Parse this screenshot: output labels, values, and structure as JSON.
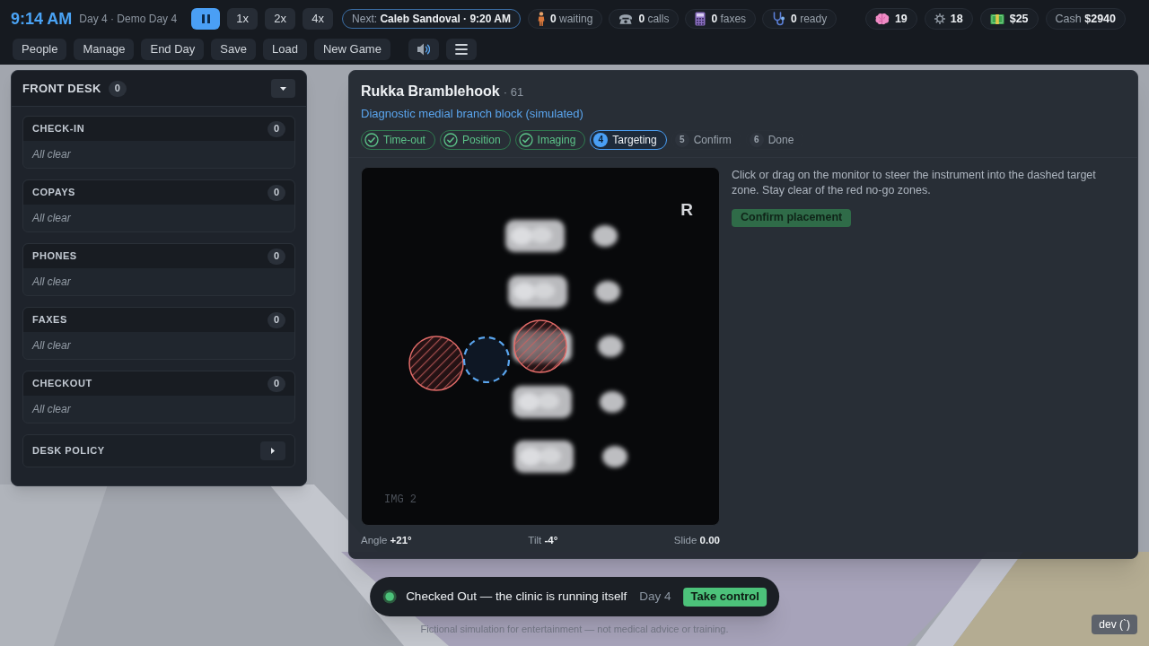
{
  "top_bar": {
    "clock": "9:14 AM",
    "day": "Day 4 · Demo Day 4",
    "speed_controls": [
      {
        "kind": "pause",
        "selected": true
      },
      {
        "kind": "speed",
        "label": "1x",
        "selected": false
      },
      {
        "kind": "speed",
        "label": "2x",
        "selected": false
      },
      {
        "kind": "speed",
        "label": "4x",
        "selected": false
      }
    ],
    "next": "Next: **Caleb Sandoval · 9:20 AM**",
    "counters": [
      {
        "kind": "waiting",
        "text": "**0** waiting"
      },
      {
        "kind": "calls",
        "text": "**0** calls"
      },
      {
        "kind": "faxes",
        "text": "**0** faxes"
      },
      {
        "kind": "ready",
        "text": "**0** ready"
      }
    ],
    "stats": [
      {
        "kind": "brain",
        "text": "19"
      },
      {
        "kind": "gear",
        "text": "18"
      },
      {
        "kind": "money",
        "text": "$25"
      },
      {
        "kind": "cash",
        "text": "Cash **$2940**"
      }
    ]
  },
  "menu_buttons": [
    {
      "label": "People"
    },
    {
      "label": "Manage"
    },
    {
      "label": "End Day"
    },
    {
      "label": "Save"
    },
    {
      "label": "Load"
    },
    {
      "label": "New Game"
    }
  ],
  "icon_buttons": [
    {
      "kind": "sound"
    },
    {
      "kind": "menu"
    }
  ],
  "front_desk": {
    "title": "FRONT DESK",
    "count": "0",
    "expanded": true,
    "sections": [
      {
        "title": "CHECK-IN",
        "count": "0",
        "message": "All clear"
      },
      {
        "title": "COPAYS",
        "count": "0",
        "message": "All clear"
      },
      {
        "title": "PHONES",
        "count": "0",
        "message": "All clear"
      },
      {
        "title": "FAXES",
        "count": "0",
        "message": "All clear"
      },
      {
        "title": "CHECKOUT",
        "count": "0",
        "message": "All clear"
      }
    ],
    "policy": {
      "title": "DESK POLICY",
      "expanded": false
    }
  },
  "procedure": {
    "patient_name": "Rukka Bramblehook",
    "patient_age": "· 61",
    "title": "Diagnostic medial branch block (simulated)",
    "steps": [
      {
        "label": "Time-out",
        "done": true,
        "selected": false
      },
      {
        "label": "Position",
        "done": true,
        "selected": false
      },
      {
        "label": "Imaging",
        "done": true,
        "selected": false
      },
      {
        "number": "4",
        "label": "Targeting",
        "done": false,
        "selected": true
      },
      {
        "number": "5",
        "label": "Confirm",
        "done": false,
        "selected": false
      },
      {
        "number": "6",
        "label": "Done",
        "done": false,
        "selected": false
      }
    ],
    "monitor": {
      "side_marker": "R",
      "image_label": "IMG 2"
    },
    "readouts": [
      {
        "text": "Angle **+21°**"
      },
      {
        "text": "Tilt **-4°**"
      },
      {
        "text": "Slide **0.00**"
      }
    ],
    "instructions": "Click or drag on the monitor to steer the instrument into the dashed target zone. Stay clear of the red no-go zones.",
    "confirm_button": {
      "label": "Confirm placement",
      "disabled": true
    }
  },
  "status_toast": {
    "text": "Checked Out — the clinic is running itself",
    "day": "Day 4",
    "action": "Take control"
  },
  "footer": "Fictional simulation for entertainment — not medical advice or training.",
  "dev_button": "dev (`)"
}
